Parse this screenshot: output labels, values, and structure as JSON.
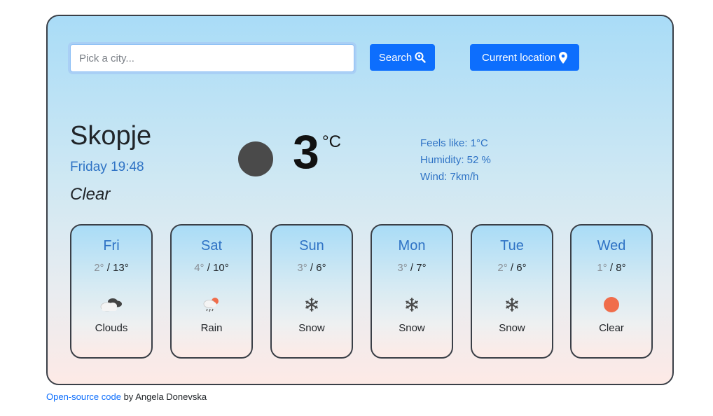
{
  "search": {
    "placeholder": "Pick a city...",
    "search_label": "Search",
    "location_label": "Current location"
  },
  "current": {
    "city": "Skopje",
    "datetime": "Friday 19:48",
    "condition": "Clear",
    "temperature": "3",
    "unit": "°C",
    "feels_like": "Feels like: 1°C",
    "humidity": "Humidity: 52 %",
    "wind": "Wind: 7km/h",
    "icon": "night-clear-moon-icon",
    "icon_color": "#4a4a4a"
  },
  "forecast": [
    {
      "day": "Fri",
      "min": "2°",
      "sep": " / ",
      "max": "13°",
      "desc": "Clouds",
      "icon": "clouds-icon"
    },
    {
      "day": "Sat",
      "min": "4°",
      "sep": " / ",
      "max": "10°",
      "desc": "Rain",
      "icon": "rain-icon"
    },
    {
      "day": "Sun",
      "min": "3°",
      "sep": " / ",
      "max": "6°",
      "desc": "Snow",
      "icon": "snowflake-icon"
    },
    {
      "day": "Mon",
      "min": "3°",
      "sep": " / ",
      "max": "7°",
      "desc": "Snow",
      "icon": "snowflake-icon"
    },
    {
      "day": "Tue",
      "min": "2°",
      "sep": " / ",
      "max": "6°",
      "desc": "Snow",
      "icon": "snowflake-icon"
    },
    {
      "day": "Wed",
      "min": "1°",
      "sep": " / ",
      "max": "8°",
      "desc": "Clear",
      "icon": "sun-icon"
    }
  ],
  "footer": {
    "link_text": "Open-source code",
    "by_text": " by Angela Donevska"
  },
  "colors": {
    "accent": "#0d6efd",
    "link_blue": "#2f73c5",
    "sun": "#f06d4b"
  }
}
